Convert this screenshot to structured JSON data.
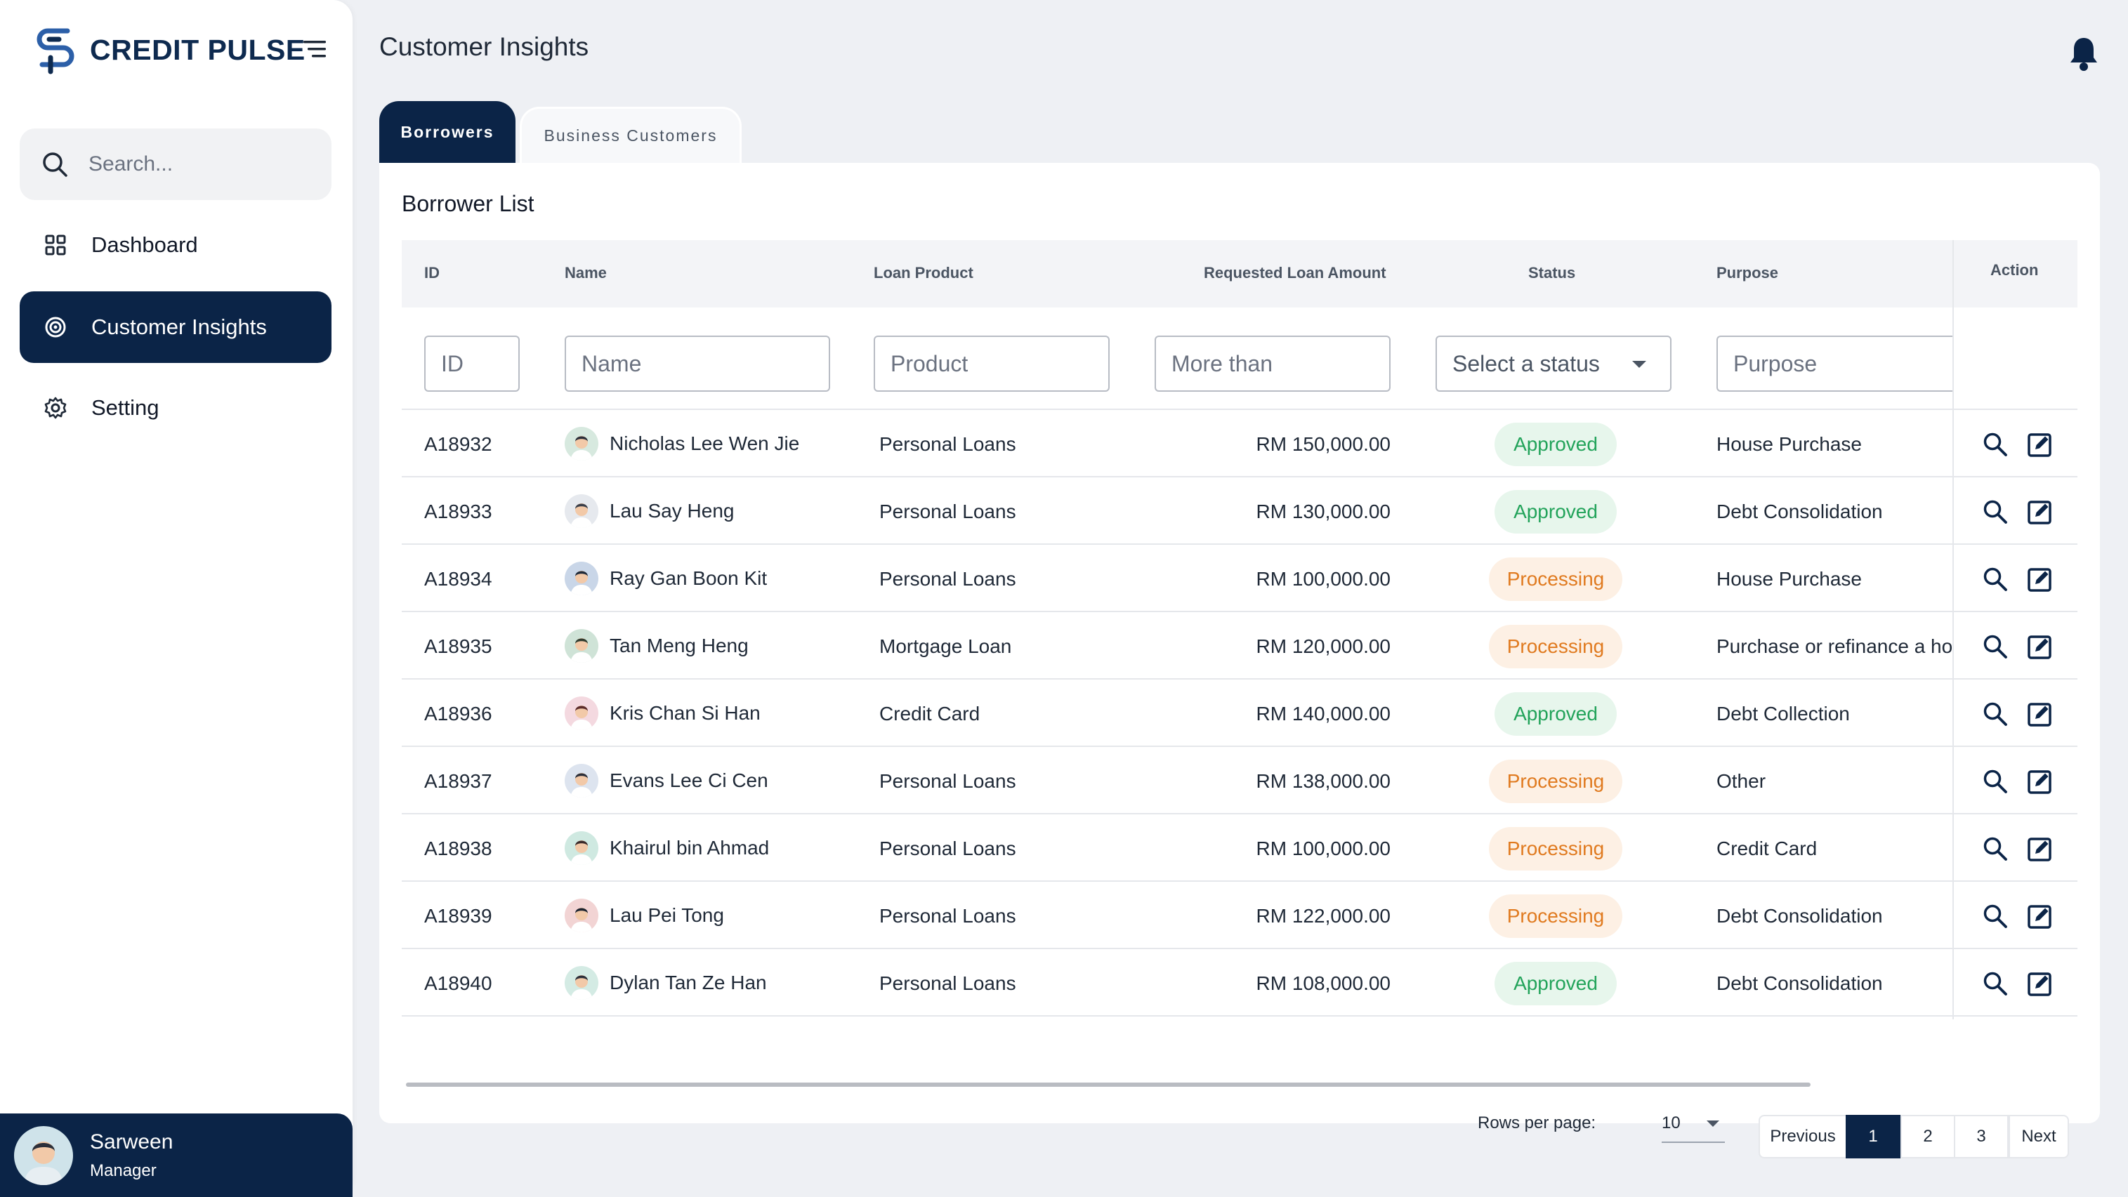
{
  "brand": {
    "name": "CREDIT PULSE"
  },
  "sidebar": {
    "search_placeholder": "Search...",
    "items": [
      {
        "label": "Dashboard",
        "icon": "grid-icon",
        "active": false
      },
      {
        "label": "Customer Insights",
        "icon": "target-icon",
        "active": true
      },
      {
        "label": "Setting",
        "icon": "gear-icon",
        "active": false
      }
    ],
    "user": {
      "name": "Sarween",
      "role": "Manager"
    }
  },
  "header": {
    "title": "Customer Insights"
  },
  "tabs": [
    {
      "label": "Borrowers",
      "active": true
    },
    {
      "label": "Business Customers",
      "active": false
    }
  ],
  "panel": {
    "title": "Borrower List"
  },
  "table": {
    "columns": [
      "ID",
      "Name",
      "Loan Product",
      "Requested Loan Amount",
      "Status",
      "Purpose",
      "Action"
    ],
    "filters": {
      "id": "ID",
      "name": "Name",
      "product": "Product",
      "amount": "More than",
      "status": "Select a status",
      "purpose": "Purpose"
    },
    "rows": [
      {
        "id": "A18932",
        "name": "Nicholas Lee Wen Jie",
        "product": "Personal Loans",
        "amount": "RM 150,000.00",
        "status": "Approved",
        "purpose": "House Purchase"
      },
      {
        "id": "A18933",
        "name": "Lau Say Heng",
        "product": "Personal Loans",
        "amount": "RM 130,000.00",
        "status": "Approved",
        "purpose": "Debt Consolidation"
      },
      {
        "id": "A18934",
        "name": "Ray Gan Boon Kit",
        "product": "Personal Loans",
        "amount": "RM 100,000.00",
        "status": "Processing",
        "purpose": "House Purchase"
      },
      {
        "id": "A18935",
        "name": "Tan Meng Heng",
        "product": "Mortgage Loan",
        "amount": "RM 120,000.00",
        "status": "Processing",
        "purpose": "Purchase or refinance a hor"
      },
      {
        "id": "A18936",
        "name": "Kris Chan Si Han",
        "product": "Credit Card",
        "amount": "RM 140,000.00",
        "status": "Approved",
        "purpose": "Debt Collection"
      },
      {
        "id": "A18937",
        "name": "Evans Lee Ci Cen",
        "product": "Personal Loans",
        "amount": "RM 138,000.00",
        "status": "Processing",
        "purpose": "Other"
      },
      {
        "id": "A18938",
        "name": "Khairul bin Ahmad",
        "product": "Personal Loans",
        "amount": "RM 100,000.00",
        "status": "Processing",
        "purpose": "Credit Card"
      },
      {
        "id": "A18939",
        "name": "Lau Pei Tong",
        "product": "Personal Loans",
        "amount": "RM 122,000.00",
        "status": "Processing",
        "purpose": "Debt Consolidation"
      },
      {
        "id": "A18940",
        "name": "Dylan Tan Ze Han",
        "product": "Personal Loans",
        "amount": "RM 108,000.00",
        "status": "Approved",
        "purpose": "Debt Consolidation"
      }
    ]
  },
  "pagination": {
    "rows_per_page_label": "Rows per page:",
    "rows_per_page": "10",
    "previous": "Previous",
    "pages": [
      "1",
      "2",
      "3"
    ],
    "current_page": "1",
    "next": "Next"
  },
  "colors": {
    "navy": "#0b2447",
    "approved_text": "#22a35a",
    "approved_bg": "#e7f6ec",
    "processing_text": "#e07a1f",
    "processing_bg": "#fdf0e4"
  }
}
